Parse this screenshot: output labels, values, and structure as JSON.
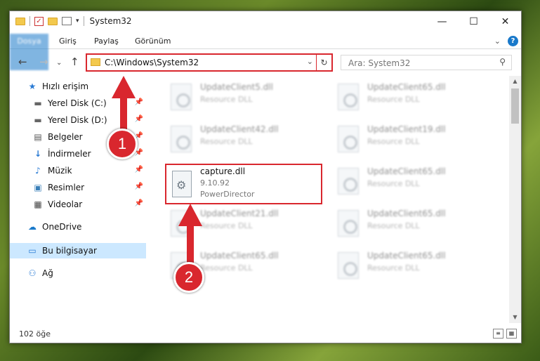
{
  "window": {
    "title": "System32",
    "minimize": "—",
    "maximize": "☐",
    "close": "✕"
  },
  "ribbon": {
    "tabs": [
      "Dosya",
      "Giriş",
      "Paylaş",
      "Görünüm"
    ]
  },
  "nav": {
    "back": "←",
    "forward": "→",
    "up": "↑",
    "path": "C:\\Windows\\System32",
    "search_placeholder": "Ara: System32"
  },
  "sidebar": {
    "items": [
      {
        "label": "Hızlı erişim",
        "icon": "★"
      },
      {
        "label": "Yerel Disk (C:)",
        "icon": "▬"
      },
      {
        "label": "Yerel Disk (D:)",
        "icon": "▬"
      },
      {
        "label": "Belgeler",
        "icon": "▤"
      },
      {
        "label": "İndirmeler",
        "icon": "↓"
      },
      {
        "label": "Müzik",
        "icon": "♪"
      },
      {
        "label": "Resimler",
        "icon": "▣"
      },
      {
        "label": "Videolar",
        "icon": "▦"
      },
      {
        "label": "OneDrive",
        "icon": "☁"
      },
      {
        "label": "Bu bilgisayar",
        "icon": "▭"
      },
      {
        "label": "Ağ",
        "icon": "⚇"
      }
    ]
  },
  "files": [
    {
      "name": "UpdateClient5.dll",
      "desc": "Resource DLL"
    },
    {
      "name": "UpdateClient65.dll",
      "desc": "Resource DLL"
    },
    {
      "name": "UpdateClient42.dll",
      "desc": "Resource DLL"
    },
    {
      "name": "UpdateClient19.dll",
      "desc": "Resource DLL"
    },
    {
      "name": "UpdateClient65.dll",
      "desc": "Resource DLL"
    },
    {
      "name": "UpdateClient21.dll",
      "desc": "Resource DLL"
    },
    {
      "name": "UpdateClient65.dll",
      "desc": "Resource DLL"
    },
    {
      "name": "UpdateClient65.dll",
      "desc": "Resource DLL"
    },
    {
      "name": "UpdateClient65.dll",
      "desc": "Resource DLL"
    }
  ],
  "selected_file": {
    "name": "capture.dll",
    "version": "9.10.92",
    "company": "PowerDirector"
  },
  "status": {
    "count": "102 öğe"
  },
  "annotations": {
    "step1": "1",
    "step2": "2"
  },
  "colors": {
    "accent": "#1979ca",
    "highlight": "#d9272e"
  }
}
